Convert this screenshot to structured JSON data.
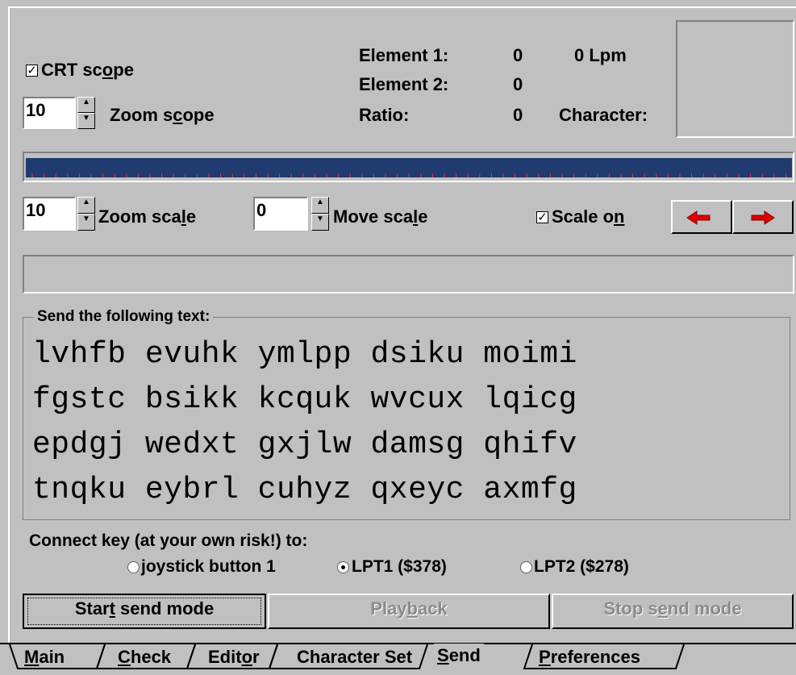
{
  "scope": {
    "crt_checked": true,
    "crt_label_pre": "CRT sc",
    "crt_label_ul": "o",
    "crt_label_post": "pe",
    "zoom_scope_value": "10",
    "zoom_scope_label_pre": "Zoom s",
    "zoom_scope_label_ul": "c",
    "zoom_scope_label_post": "ope"
  },
  "stats": {
    "element1_label": "Element 1:",
    "element1_value": "0",
    "lpm": "0 Lpm",
    "element2_label": "Element 2:",
    "element2_value": "0",
    "ratio_label": "Ratio:",
    "ratio_value": "0",
    "character_label": "Character:"
  },
  "scale": {
    "zoom_value": "10",
    "zoom_label_pre": "Zoom sca",
    "zoom_label_ul": "l",
    "zoom_label_post": "e",
    "move_value": "0",
    "move_label_pre": "Move sca",
    "move_label_ul": "l",
    "move_label_post": "e",
    "scale_on_checked": true,
    "scale_on_pre": "Scale o",
    "scale_on_ul": "n",
    "bar_color": "#1f3a6e",
    "tick_color": "#ff3030"
  },
  "send_group": {
    "title": "Send the following text:",
    "lines": [
      "lvhfb evuhk ymlpp dsiku moimi",
      "fgstc bsikk kcquk wvcux lqicg",
      "epdgj wedxt gxjlw damsg qhifv",
      "tnqku eybrl cuhyz qxeyc axmfg"
    ]
  },
  "connect": {
    "label": "Connect key (at your own risk!) to:",
    "options": [
      {
        "label": "joystick button 1",
        "selected": false
      },
      {
        "label": "LPT1 ($378)",
        "selected": true
      },
      {
        "label": "LPT2 ($278)",
        "selected": false
      }
    ]
  },
  "buttons": {
    "start_pre": "Star",
    "start_ul": "t",
    "start_post": " send mode",
    "playback_pre": "Play",
    "playback_ul": "b",
    "playback_post": "ack",
    "stop_pre": "Stop s",
    "stop_ul": "e",
    "stop_post": "nd mode"
  },
  "tabs": [
    {
      "ul": "M",
      "rest": "ain"
    },
    {
      "ul": "C",
      "rest": "heck"
    },
    {
      "pre": "Edit",
      "ul": "o",
      "rest": "r"
    },
    {
      "pre": "Character Set",
      "ul": "",
      "rest": ""
    },
    {
      "ul": "S",
      "rest": "end"
    },
    {
      "ul": "P",
      "rest": "references"
    }
  ],
  "active_tab": "Send"
}
